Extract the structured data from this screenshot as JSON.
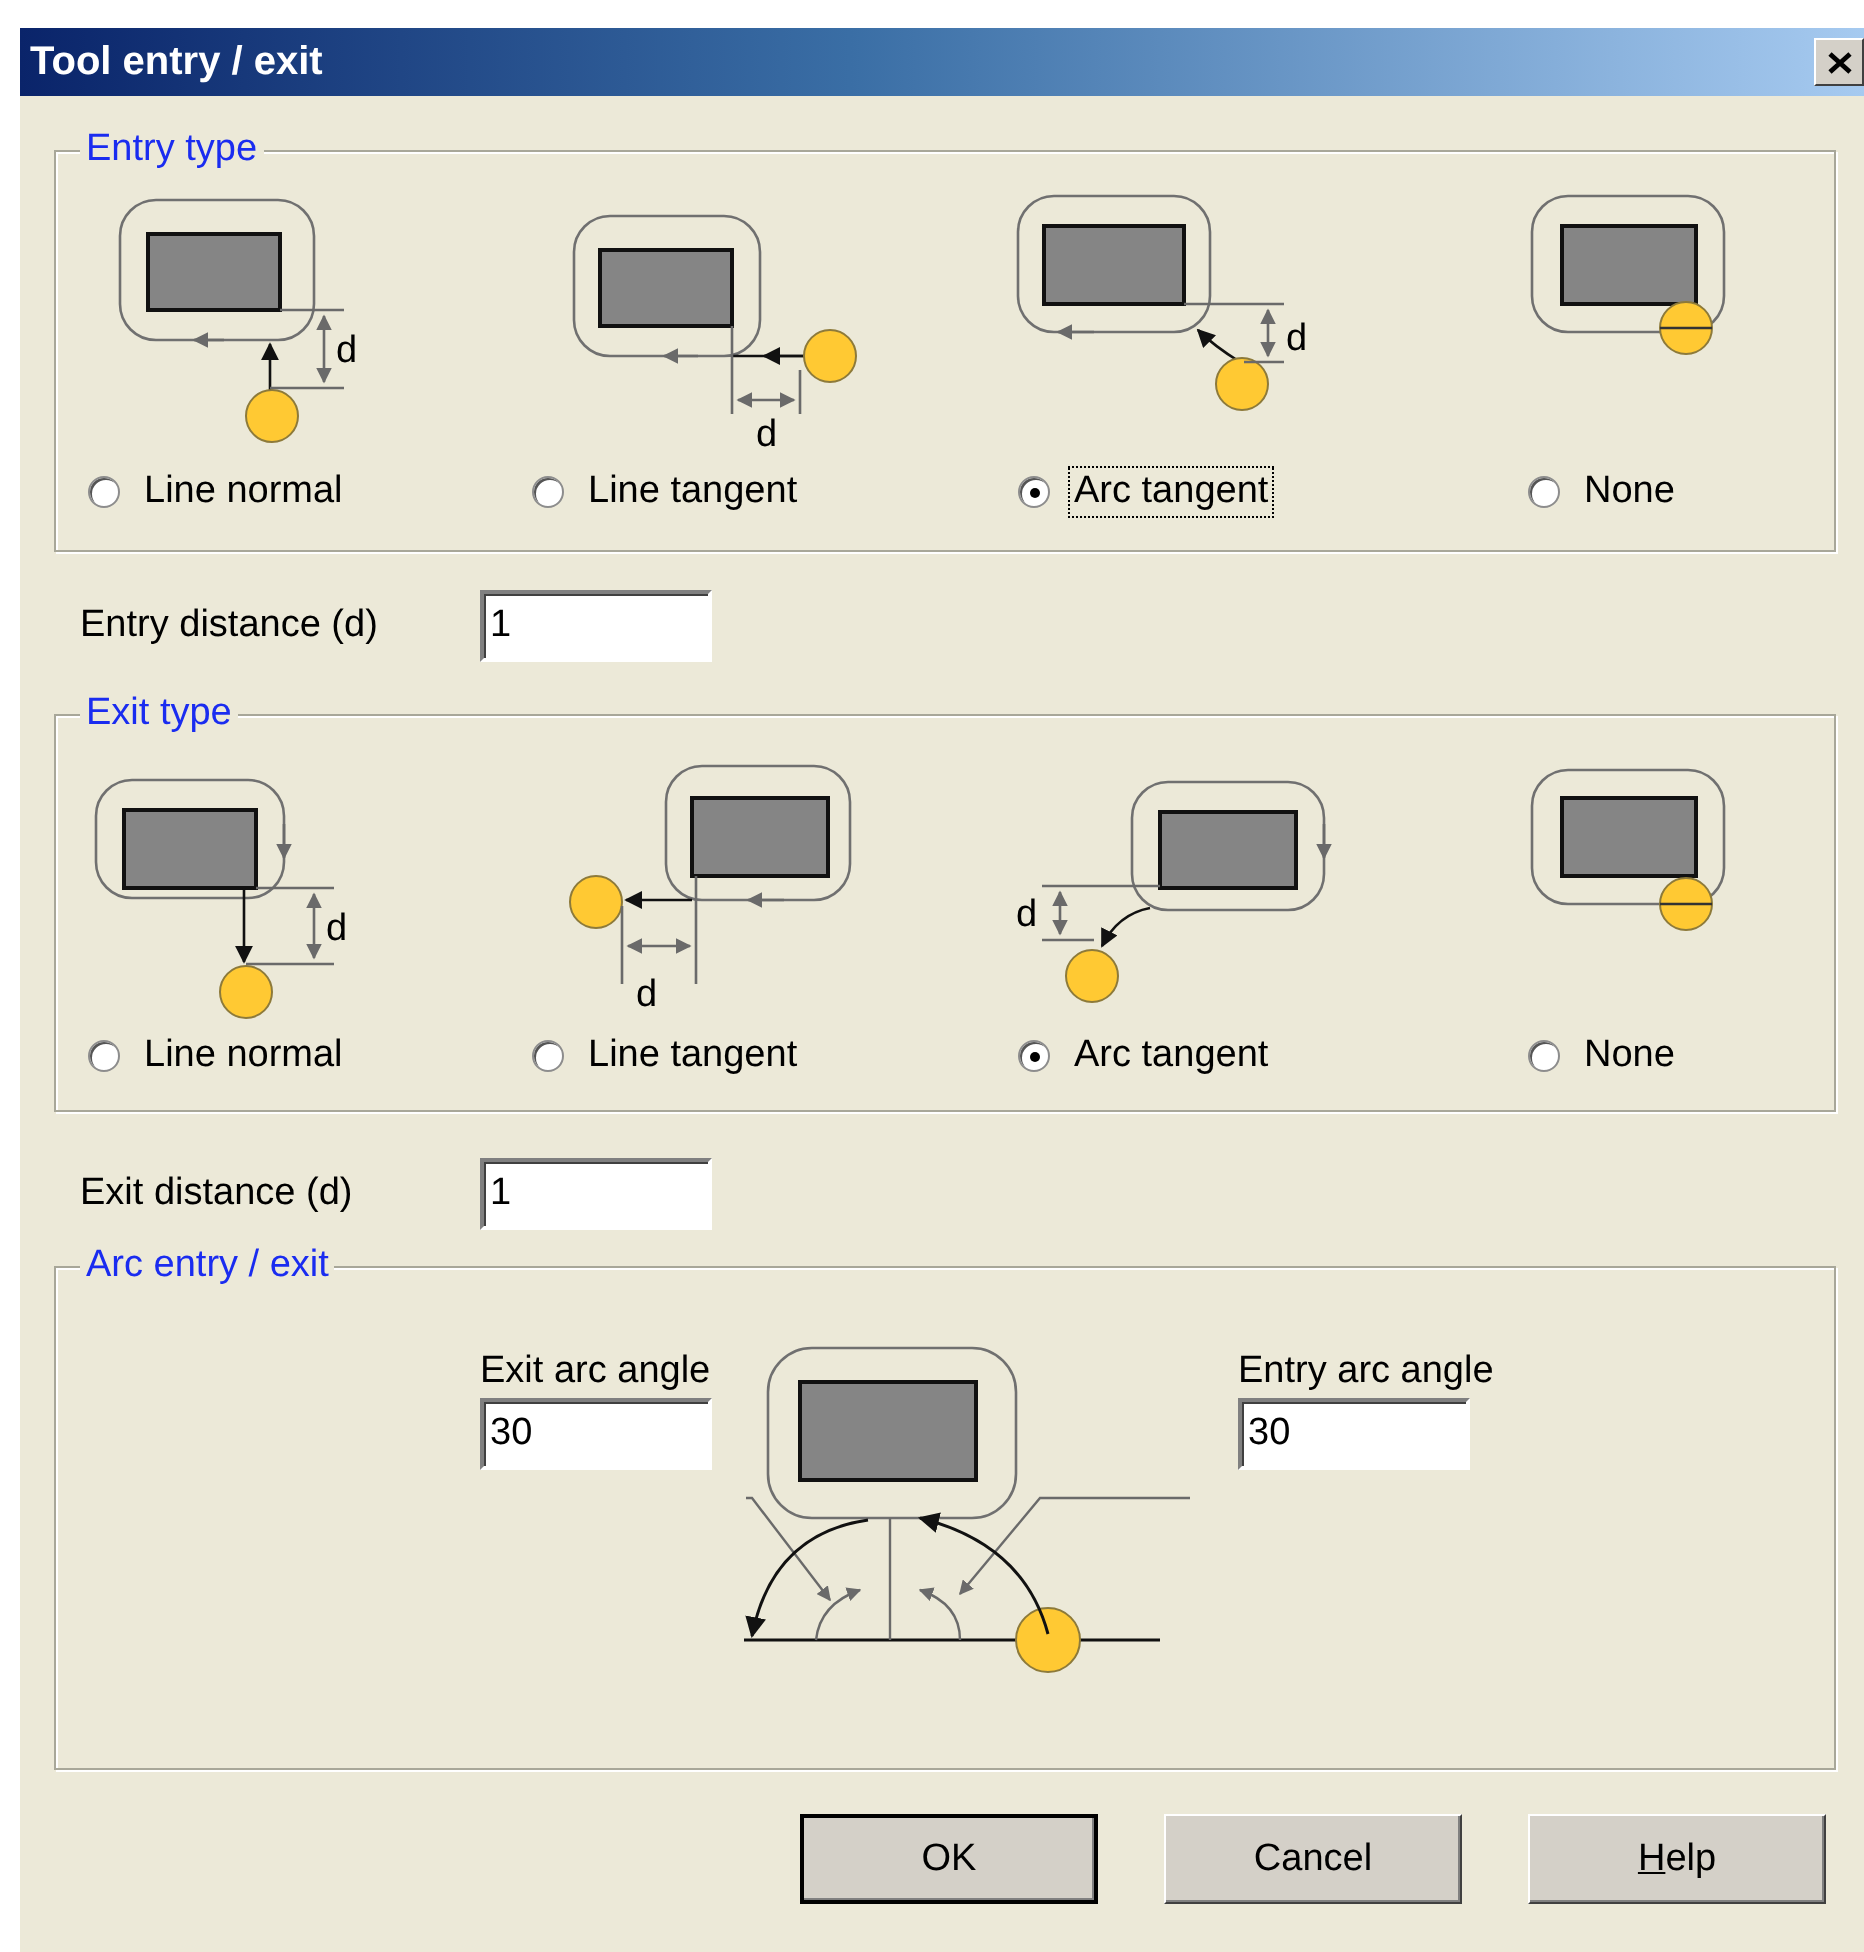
{
  "window": {
    "title": "Tool entry / exit"
  },
  "entry": {
    "title": "Entry type",
    "options": [
      {
        "kind": "line_normal",
        "label": "Line normal",
        "dimension_label": "d",
        "selected": false,
        "focused": false
      },
      {
        "kind": "line_tangent",
        "label": "Line tangent",
        "dimension_label": "d",
        "selected": false,
        "focused": false
      },
      {
        "kind": "arc_tangent",
        "label": "Arc tangent",
        "dimension_label": "d",
        "selected": true,
        "focused": true
      },
      {
        "kind": "none",
        "label": "None",
        "selected": false,
        "focused": false
      }
    ],
    "distance": {
      "label": "Entry distance (d)",
      "value": "1"
    }
  },
  "exit": {
    "title": "Exit type",
    "options": [
      {
        "kind": "line_normal",
        "label": "Line normal",
        "dimension_label": "d",
        "selected": false,
        "focused": false
      },
      {
        "kind": "line_tangent",
        "label": "Line tangent",
        "dimension_label": "d",
        "selected": false,
        "focused": false
      },
      {
        "kind": "arc_tangent",
        "label": "Arc tangent",
        "dimension_label": "d",
        "selected": true,
        "focused": false
      },
      {
        "kind": "none",
        "label": "None",
        "selected": false,
        "focused": false
      }
    ],
    "distance": {
      "label": "Exit distance (d)",
      "value": "1"
    }
  },
  "arc": {
    "title": "Arc entry / exit",
    "exit_angle": {
      "label": "Exit arc angle",
      "value": "30"
    },
    "entry_angle": {
      "label": "Entry arc angle",
      "value": "30"
    }
  },
  "buttons": [
    {
      "kind": "default",
      "label": "OK",
      "underline_first": false
    },
    {
      "kind": "normal",
      "label": "Cancel",
      "underline_first": false
    },
    {
      "kind": "normal",
      "label": "Help",
      "underline_first": true
    }
  ]
}
